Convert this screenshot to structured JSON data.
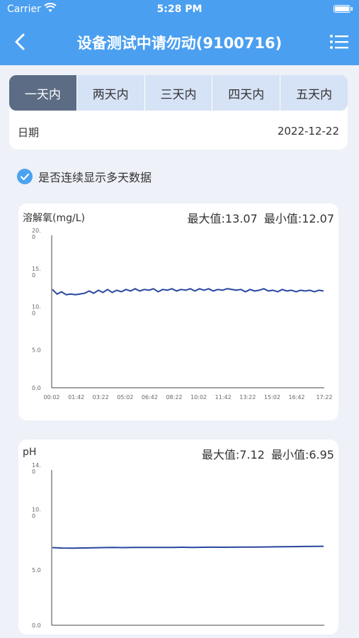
{
  "status_bar": {
    "carrier": "Carrier",
    "time": "5:28 PM"
  },
  "nav": {
    "title": "设备测试中请勿动(9100716)"
  },
  "tabs": [
    {
      "label": "一天内",
      "active": true
    },
    {
      "label": "两天内",
      "active": false
    },
    {
      "label": "三天内",
      "active": false
    },
    {
      "label": "四天内",
      "active": false
    },
    {
      "label": "五天内",
      "active": false
    }
  ],
  "date": {
    "label": "日期",
    "value": "2022-12-22"
  },
  "continuous": {
    "label": "是否连续显示多天数据",
    "checked": true
  },
  "colors": {
    "primary": "#4a9ff0",
    "active_tab": "#5c6c85",
    "line": "#2946a0"
  },
  "charts": [
    {
      "name": "溶解氧(mg/L)",
      "max_label": "最大值:13.07",
      "min_label": "最小值:12.07",
      "y_ticks": [
        "20.\n0",
        "15.\n0",
        "10.\n0",
        "5.0",
        "0.0"
      ],
      "x_ticks": [
        "00:02",
        "01:42",
        "03:22",
        "05:02",
        "06:42",
        "08:22",
        "10:02",
        "11:42",
        "13:22",
        "15:02",
        "16:42",
        "17:22"
      ]
    },
    {
      "name": "pH",
      "max_label": "最大值:7.12",
      "min_label": "最小值:6.95",
      "y_ticks": [
        "14.\n0",
        "10.\n0",
        "5.0",
        "0.0"
      ],
      "x_ticks": []
    }
  ],
  "chart_data": [
    {
      "type": "line",
      "title": "溶解氧(mg/L)",
      "ylim": [
        0,
        20
      ],
      "y_ticks": [
        0,
        5,
        10,
        15,
        20
      ],
      "x_ticks": [
        "00:02",
        "01:42",
        "03:22",
        "05:02",
        "06:42",
        "08:22",
        "10:02",
        "11:42",
        "13:22",
        "15:02",
        "16:42",
        "17:22"
      ],
      "series": [
        {
          "values": [
            12.9,
            12.3,
            12.6,
            12.2,
            12.3,
            12.2,
            12.3,
            12.4,
            12.7,
            12.4,
            12.8,
            12.5,
            12.9,
            12.5,
            12.8,
            12.6,
            12.9,
            12.7,
            13.0,
            12.7,
            12.9,
            12.8,
            13.0,
            12.6,
            12.9,
            12.8,
            13.0,
            12.7,
            12.9,
            12.8,
            13.0,
            12.7,
            13.0,
            12.8,
            13.0,
            12.7,
            12.9,
            12.8,
            13.0,
            12.9,
            12.8,
            12.9,
            12.6,
            12.9,
            12.7,
            12.8,
            13.0,
            12.7,
            12.8,
            12.6,
            12.9,
            12.7,
            12.8,
            12.6,
            12.8,
            12.7,
            12.8,
            12.6,
            12.8,
            12.7
          ]
        }
      ]
    },
    {
      "type": "line",
      "title": "pH",
      "ylim": [
        0,
        14
      ],
      "y_ticks": [
        0,
        5,
        10,
        14
      ],
      "series": [
        {
          "values": [
            7.0,
            6.96,
            6.95,
            6.97,
            6.98,
            7.0,
            7.01,
            7.0,
            7.01,
            7.02,
            7.02,
            7.01,
            7.02,
            7.03,
            7.02,
            7.03,
            7.04,
            7.03,
            7.04,
            7.05,
            7.05,
            7.06,
            7.07,
            7.08,
            7.09,
            7.1,
            7.11,
            7.12
          ]
        }
      ]
    }
  ]
}
